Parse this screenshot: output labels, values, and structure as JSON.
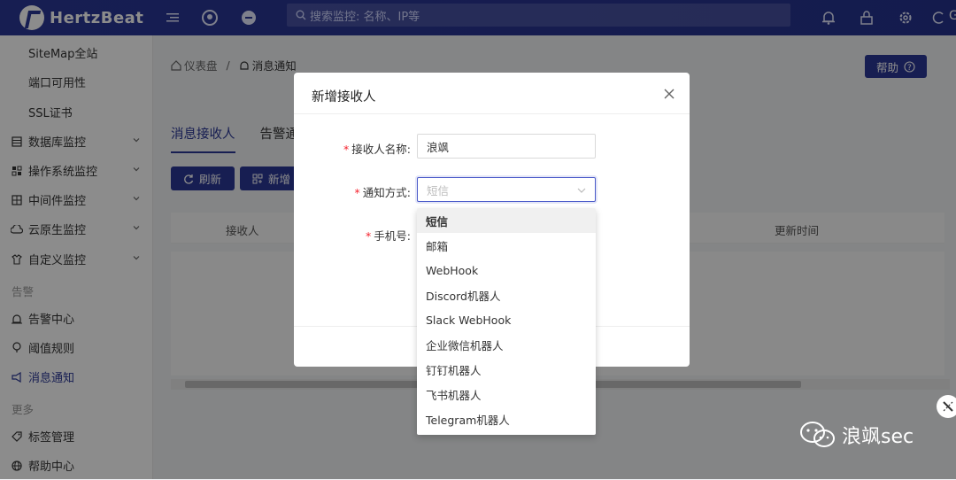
{
  "app": {
    "logo_text": "HertzBeat"
  },
  "search": {
    "placeholder": "搜索监控: 名称、IP等"
  },
  "topbar": {
    "right_partial_label": "G"
  },
  "sidebar": {
    "sub_items": [
      "SiteMap全站",
      "端口可用性",
      "SSL证书"
    ],
    "items": [
      {
        "label": "数据库监控",
        "icon": "database-icon"
      },
      {
        "label": "操作系统监控",
        "icon": "os-icon"
      },
      {
        "label": "中间件监控",
        "icon": "middleware-icon"
      },
      {
        "label": "云原生监控",
        "icon": "cloud-icon"
      },
      {
        "label": "自定义监控",
        "icon": "custom-icon"
      }
    ],
    "group_alert": "告警",
    "alert_items": [
      {
        "label": "告警中心",
        "icon": "alarm-icon"
      },
      {
        "label": "阈值规则",
        "icon": "bulb-icon"
      },
      {
        "label": "消息通知",
        "icon": "notify-icon"
      }
    ],
    "group_more": "更多",
    "more_items": [
      {
        "label": "标签管理",
        "icon": "tag-icon"
      },
      {
        "label": "帮助中心",
        "icon": "help-circle-icon"
      }
    ]
  },
  "breadcrumb": {
    "home": "仪表盘",
    "separator": "/",
    "current": "消息通知"
  },
  "help_button": "帮助",
  "tabs": [
    "消息接收人",
    "告警通"
  ],
  "buttons": {
    "refresh": "刷新",
    "add": "新增"
  },
  "table": {
    "columns": [
      "接收人",
      "更新时间"
    ]
  },
  "modal": {
    "title": "新增接收人",
    "fields": {
      "name_label": "接收人名称:",
      "name_value": "浪飒",
      "method_label": "通知方式:",
      "method_value": "短信",
      "phone_label": "手机号:"
    }
  },
  "dropdown": {
    "options": [
      "短信",
      "邮箱",
      "WebHook",
      "Discord机器人",
      "Slack WebHook",
      "企业微信机器人",
      "钉钉机器人",
      "飞书机器人",
      "Telegram机器人"
    ],
    "selected_index": 0
  },
  "watermark": {
    "text": "浪飒sec"
  },
  "colors": {
    "primary": "#2a3796",
    "required": "#f5222d"
  }
}
